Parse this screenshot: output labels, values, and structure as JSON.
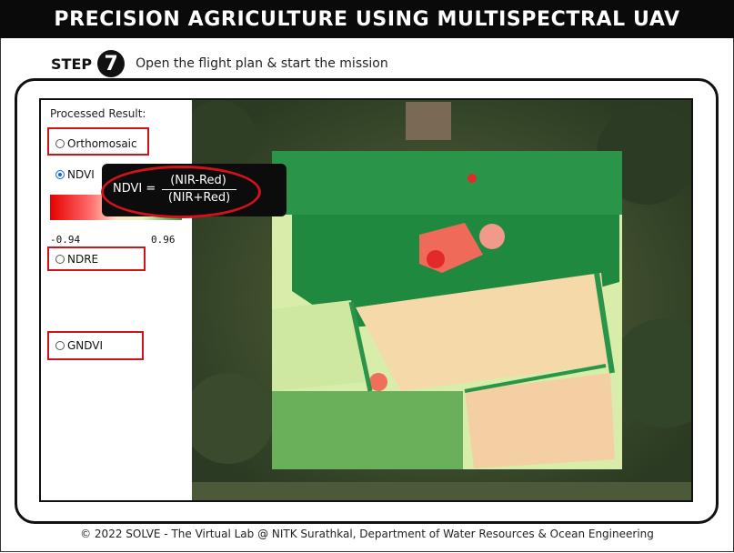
{
  "header": {
    "title": "PRECISION AGRICULTURE USING MULTISPECTRAL UAV"
  },
  "step": {
    "label": "STEP",
    "number": "7",
    "instruction": "Open the flight plan & start the mission"
  },
  "panel": {
    "title": "Processed Result:",
    "options": [
      {
        "label": "Orthomosaic",
        "selected": false,
        "highlighted": true
      },
      {
        "label": "NDVI",
        "selected": true,
        "highlighted": false
      },
      {
        "label": "NDRE",
        "selected": false,
        "highlighted": true
      },
      {
        "label": "GNDVI",
        "selected": false,
        "highlighted": true
      }
    ],
    "legend": {
      "min": "-0.94",
      "max": "0.96",
      "colors": [
        "#e60000",
        "#ffe0c8",
        "#2a9d3a"
      ]
    }
  },
  "formula": {
    "lhs": "NDVI =",
    "numerator": "(NIR-Red)",
    "denominator": "(NIR+Red)"
  },
  "colors": {
    "highlight": "#d0121b",
    "titlebar": "#0a0a0a",
    "radio_selected": "#1565d8"
  },
  "footer": {
    "text": "© 2022 SOLVE - The Virtual Lab @ NITK Surathkal, Department of Water Resources & Ocean Engineering"
  }
}
